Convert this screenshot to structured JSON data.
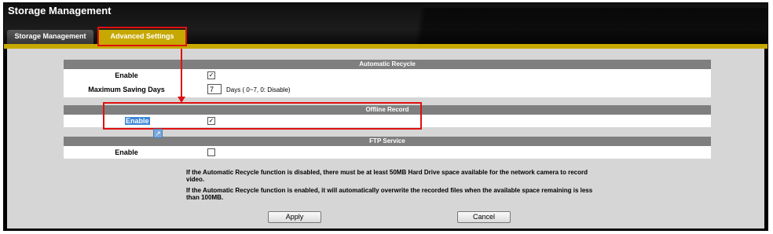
{
  "window": {
    "title": "Storage Management"
  },
  "tabs": [
    {
      "label": "Storage Management",
      "active": false
    },
    {
      "label": "Advanced Settings",
      "active": true
    }
  ],
  "sections": {
    "automatic_recycle": {
      "title": "Automatic Recycle",
      "enable_label": "Enable",
      "enable_checked": true,
      "max_days_label": "Maximum Saving Days",
      "max_days_value": "7",
      "max_days_hint": "Days ( 0~7, 0: Disable)"
    },
    "offline_record": {
      "title": "Offline Record",
      "enable_label": "Enable",
      "enable_checked": true
    },
    "ftp_service": {
      "title": "FTP Service",
      "enable_label": "Enable",
      "enable_checked": false
    }
  },
  "notes": {
    "line1": "If the Automatic Recycle function is disabled, there must be at least 50MB Hard Drive space available for the network camera to record video.",
    "line2": "If the Automatic Recycle function is enabled, it will automatically overwrite the recorded files when the available space remaining is less than 100MB."
  },
  "buttons": {
    "apply": "Apply",
    "cancel": "Cancel"
  },
  "colors": {
    "accent_gold": "#c6a800",
    "annotation_red": "#e01010",
    "section_gray": "#7f7f7f"
  },
  "icons": {
    "check": "✓",
    "cursor": "↗"
  }
}
